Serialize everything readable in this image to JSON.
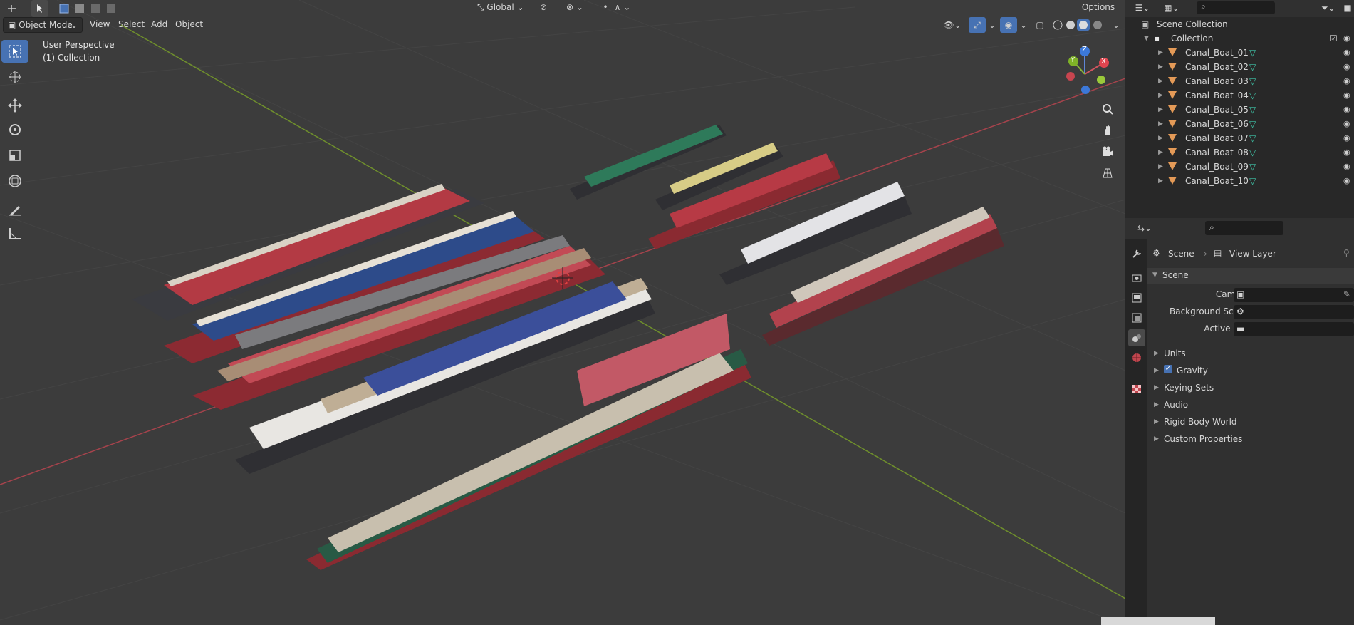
{
  "header": {
    "mode_label": "Object Mode",
    "menus": [
      "View",
      "Select",
      "Add",
      "Object"
    ],
    "transform_orientation": "Global",
    "options_label": "Options"
  },
  "viewport_overlay": {
    "perspective": "User Perspective",
    "collection": "(1) Collection"
  },
  "gizmo": {
    "x": "X",
    "y": "Y",
    "z": "Z"
  },
  "outliner": {
    "root": "Scene Collection",
    "collection": "Collection",
    "objects": [
      "Canal_Boat_01",
      "Canal_Boat_02",
      "Canal_Boat_03",
      "Canal_Boat_04",
      "Canal_Boat_05",
      "Canal_Boat_06",
      "Canal_Boat_07",
      "Canal_Boat_08",
      "Canal_Boat_09",
      "Canal_Boat_10"
    ]
  },
  "properties": {
    "breadcrumb_scene": "Scene",
    "breadcrumb_layer": "View Layer",
    "panel_title": "Scene",
    "camera_label": "Camera",
    "background_label": "Background Scene",
    "clip_label": "Active Clip",
    "sections": [
      "Units",
      "Gravity",
      "Keying Sets",
      "Audio",
      "Rigid Body World",
      "Custom Properties"
    ],
    "gravity_checked": true
  },
  "colors": {
    "selection_blue": "#4772b3",
    "axis_x": "#c8454f",
    "axis_y": "#7fb227",
    "axis_z": "#3c78d8",
    "object_orange": "#e49a57",
    "mesh_teal": "#3fc5a8"
  }
}
